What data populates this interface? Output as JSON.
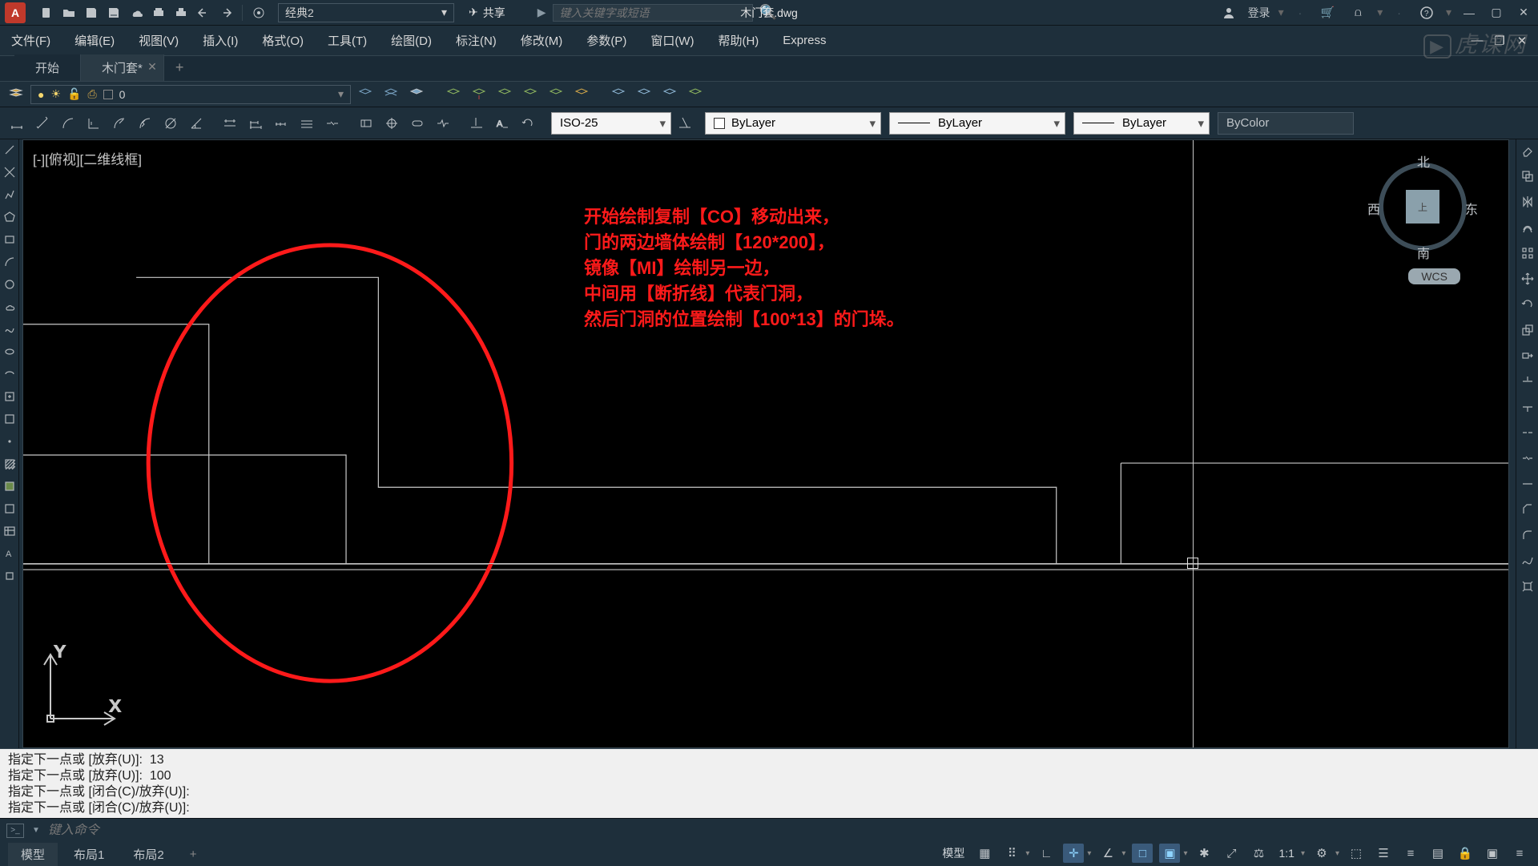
{
  "title_bar": {
    "logo_letter": "A",
    "workspace": "经典2",
    "share_label": "共享",
    "filename": "木门套.dwg",
    "search_placeholder": "键入关键字或短语",
    "login_label": "登录"
  },
  "menu": {
    "items": [
      "文件(F)",
      "编辑(E)",
      "视图(V)",
      "插入(I)",
      "格式(O)",
      "工具(T)",
      "绘图(D)",
      "标注(N)",
      "修改(M)",
      "参数(P)",
      "窗口(W)",
      "帮助(H)",
      "Express"
    ]
  },
  "doc_tabs": {
    "tab1": "开始",
    "tab2": "木门套*"
  },
  "layer": {
    "current": "0"
  },
  "props": {
    "dimstyle": "ISO-25",
    "layer_color": "ByLayer",
    "linetype": "ByLayer",
    "lineweight": "ByLayer",
    "plot_style": "ByColor"
  },
  "viewport_label": "[-][俯视][二维线框]",
  "annotation_lines": [
    "开始绘制复制【CO】移动出来，",
    "门的两边墙体绘制【120*200】，",
    "镜像【MI】绘制另一边，",
    "中间用【断折线】代表门洞，",
    "然后门洞的位置绘制【100*13】的门垛。"
  ],
  "viewcube": {
    "n": "北",
    "s": "南",
    "e": "东",
    "w": "西",
    "face": "上",
    "wcs": "WCS"
  },
  "ucs": {
    "x": "X",
    "y": "Y"
  },
  "command_history": [
    "指定下一点或 [放弃(U)]:  13",
    "指定下一点或 [放弃(U)]:  100",
    "指定下一点或 [闭合(C)/放弃(U)]:",
    "指定下一点或 [闭合(C)/放弃(U)]:"
  ],
  "command_input_placeholder": "键入命令",
  "layout_tabs": {
    "model": "模型",
    "layout1": "布局1",
    "layout2": "布局2"
  },
  "status": {
    "model_label": "模型",
    "scale": "1:1"
  },
  "watermark": "虎课网"
}
